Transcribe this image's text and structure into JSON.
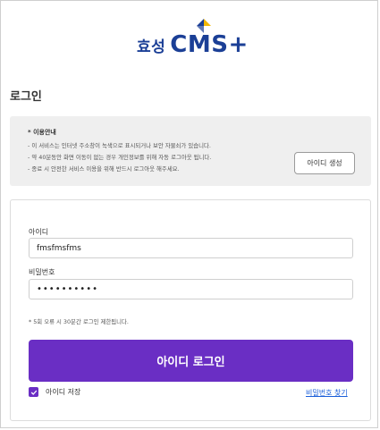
{
  "brand": {
    "name_korean": "효성",
    "name_product": "CMS+"
  },
  "page": {
    "title": "로그인"
  },
  "notice": {
    "title": "* 이용안내",
    "lines": [
      "- 이 서비스는 인터넷 주소창이 녹색으로 표시되거나 보안 자물쇠가 있습니다.",
      "- 약 40분동안 화면 이동이 없는 경우 개인정보를 위해 자동 로그아웃 됩니다.",
      "- 종료 시 안전한 서비스 이용을 위해 반드시 로그아웃 해주세요."
    ],
    "create_id_label": "아이디 생성"
  },
  "login": {
    "id_label": "아이디",
    "id_value": "fmsfmsfms",
    "password_label": "비밀번호",
    "password_value": "••••••••••",
    "lock_note": "* 5회 오류 시 30분간 로그인 제한됩니다.",
    "login_button_label": "아이디 로그인",
    "save_id_label": "아이디 저장",
    "save_id_checked": true,
    "find_password_label": "비밀번호 찾기"
  },
  "colors": {
    "brand_blue": "#1b3f96",
    "brand_yellow": "#f2b705",
    "accent_purple": "#6a2ec4",
    "link_blue": "#1b5fd9"
  },
  "icons": {
    "logo_mark": "hyosung-diamond-logo-icon",
    "checkbox": "checkmark-icon"
  }
}
